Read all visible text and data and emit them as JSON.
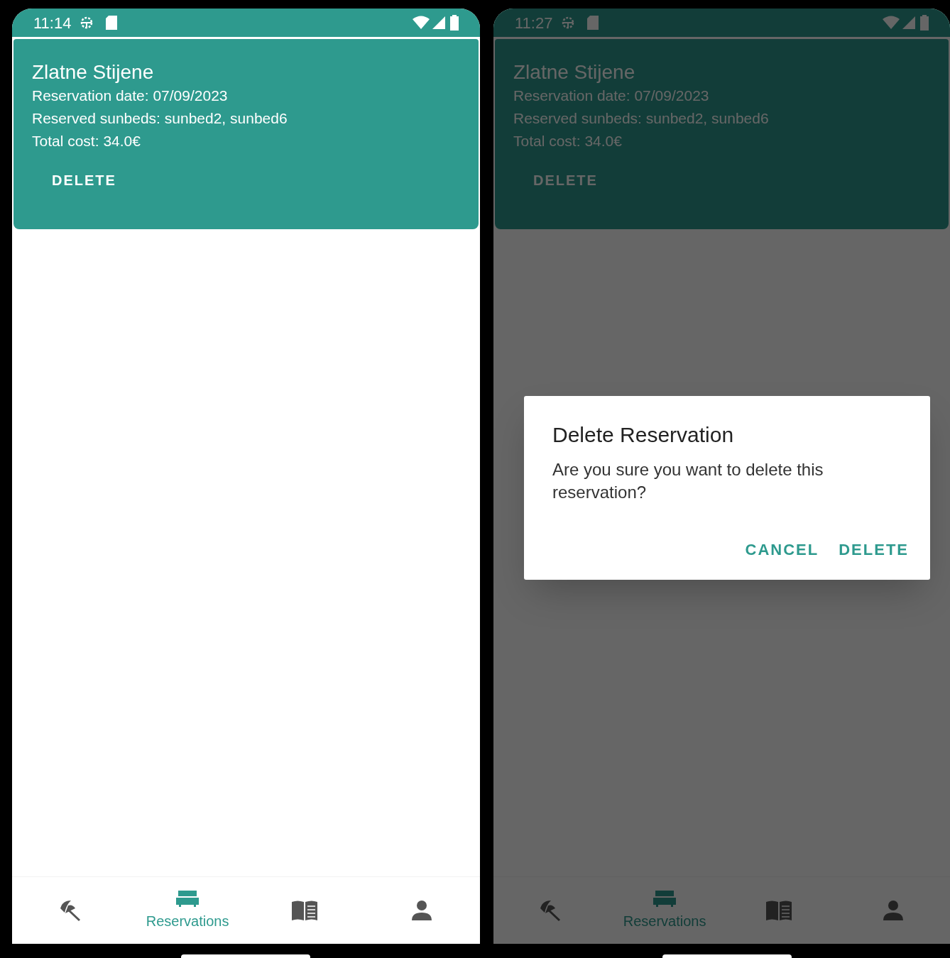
{
  "screens": [
    {
      "status_bar": {
        "time": "11:14"
      },
      "card": {
        "title": "Zlatne Stijene",
        "lines": [
          "Reservation date: 07/09/2023",
          "Reserved sunbeds: sunbed2, sunbed6",
          "Total cost: 34.0€"
        ],
        "button": "DELETE"
      },
      "bottom_nav": [
        {
          "kind": "beach",
          "selected": false
        },
        {
          "kind": "bed",
          "label": "Reservations",
          "selected": true
        },
        {
          "kind": "book",
          "selected": false
        },
        {
          "kind": "person",
          "selected": false
        }
      ]
    },
    {
      "status_bar": {
        "time": "11:27"
      },
      "card": {
        "title": "Zlatne Stijene",
        "lines": [
          "Reservation date: 07/09/2023",
          "Reserved sunbeds: sunbed2, sunbed6",
          "Total cost: 34.0€"
        ],
        "button": "DELETE"
      },
      "bottom_nav": [
        {
          "kind": "beach",
          "selected": false
        },
        {
          "kind": "bed",
          "label": "Reservations",
          "selected": true
        },
        {
          "kind": "book",
          "selected": false
        },
        {
          "kind": "person",
          "selected": false
        }
      ],
      "dialog": {
        "title": "Delete Reservation",
        "message": "Are you sure you want to delete this reservation?",
        "buttons": [
          "CANCEL",
          "DELETE"
        ]
      }
    }
  ]
}
